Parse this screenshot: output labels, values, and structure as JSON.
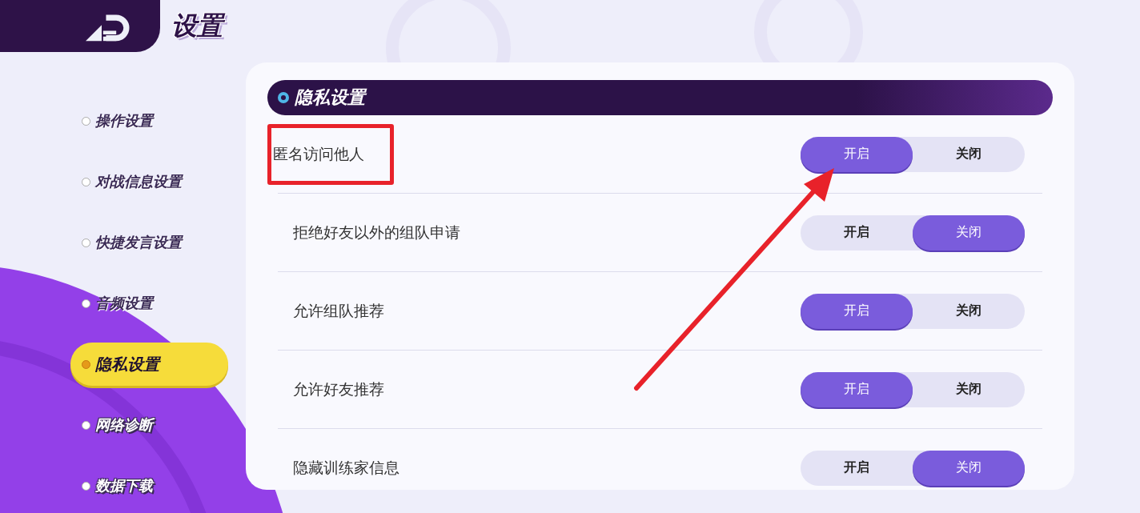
{
  "header": {
    "title": "设置"
  },
  "sidebar": {
    "items": [
      {
        "label": "操作设置",
        "selected": false
      },
      {
        "label": "对战信息设置",
        "selected": false
      },
      {
        "label": "快捷发言设置",
        "selected": false
      },
      {
        "label": "音频设置",
        "selected": false
      },
      {
        "label": "隐私设置",
        "selected": true
      },
      {
        "label": "网络诊断",
        "selected": false
      },
      {
        "label": "数据下载",
        "selected": false
      }
    ]
  },
  "section": {
    "title": "隐私设置"
  },
  "rows": [
    {
      "label": "匿名访问他人",
      "highlighted": true,
      "options": [
        {
          "label": "开启",
          "selected": true
        },
        {
          "label": "关闭",
          "selected": false
        }
      ]
    },
    {
      "label": "拒绝好友以外的组队申请",
      "highlighted": false,
      "options": [
        {
          "label": "开启",
          "selected": false
        },
        {
          "label": "关闭",
          "selected": true
        }
      ]
    },
    {
      "label": "允许组队推荐",
      "highlighted": false,
      "options": [
        {
          "label": "开启",
          "selected": true
        },
        {
          "label": "关闭",
          "selected": false
        }
      ]
    },
    {
      "label": "允许好友推荐",
      "highlighted": false,
      "options": [
        {
          "label": "开启",
          "selected": true
        },
        {
          "label": "关闭",
          "selected": false
        }
      ]
    },
    {
      "label": "隐藏训练家信息",
      "highlighted": false,
      "options": [
        {
          "label": "开启",
          "selected": false
        },
        {
          "label": "关闭",
          "selected": true
        }
      ]
    }
  ],
  "annotations": [
    {
      "kind": "arrow"
    }
  ]
}
